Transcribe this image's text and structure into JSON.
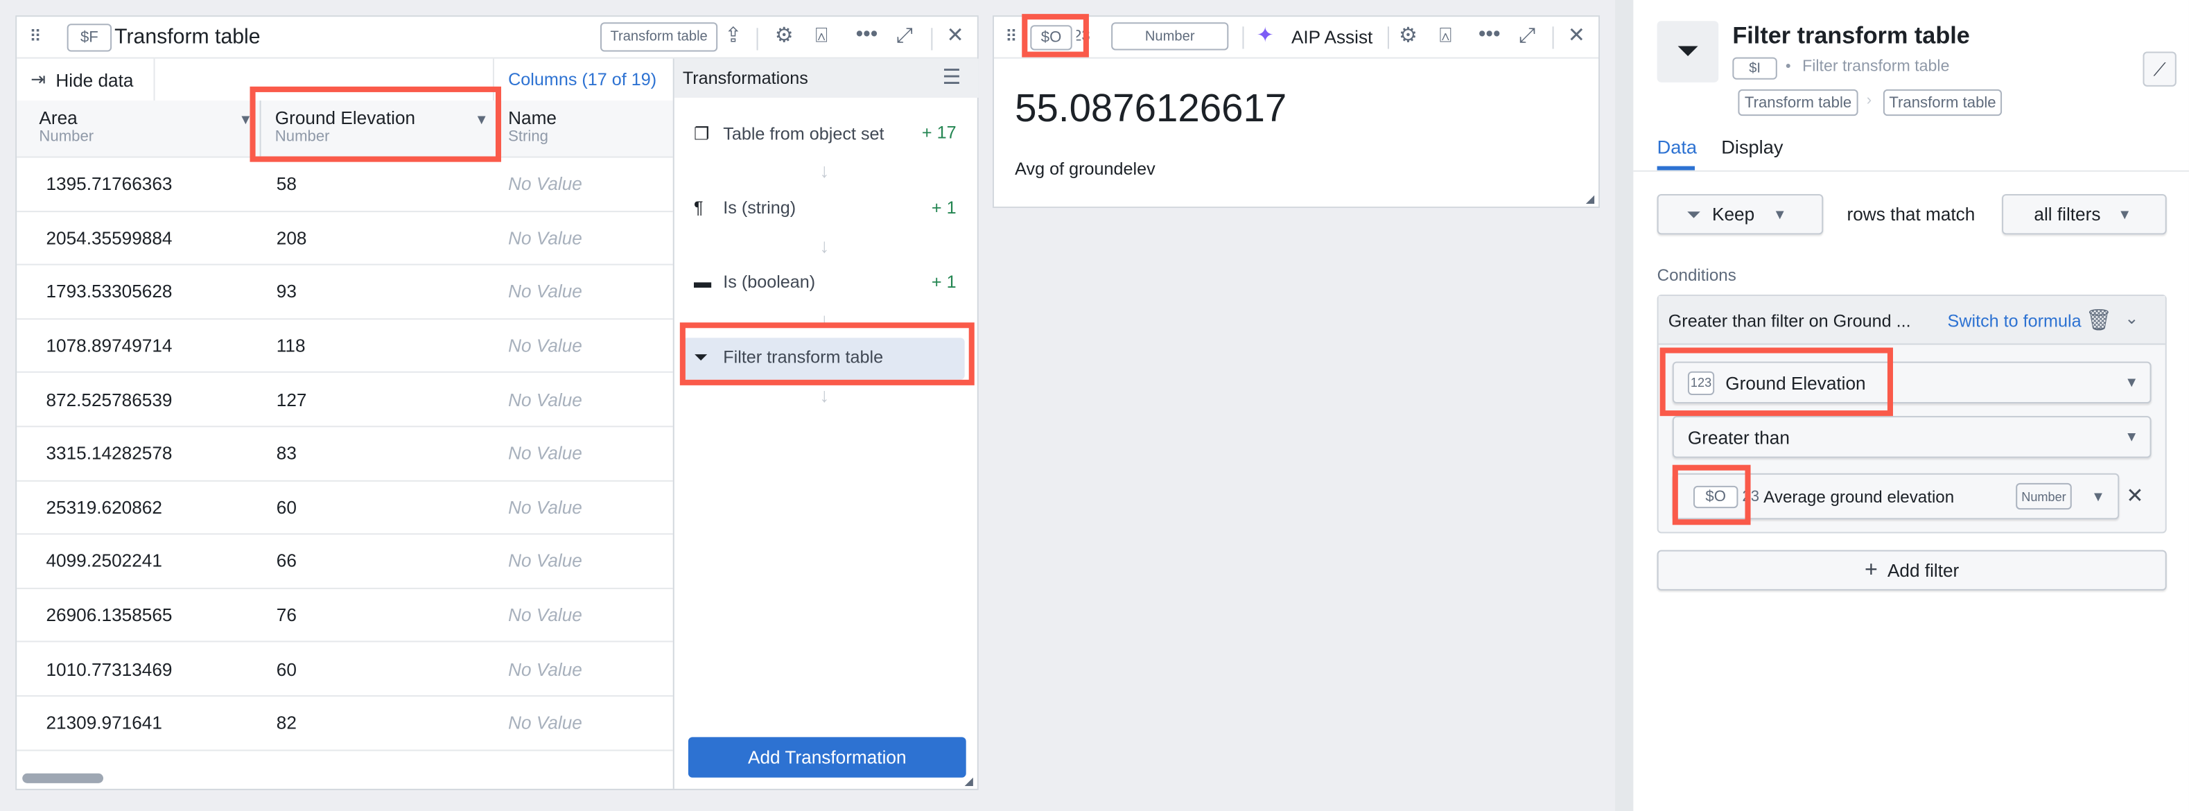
{
  "table_widget": {
    "variable": "$F",
    "title": "Transform table",
    "type_badge": "Transform table",
    "hide_data": "Hide data",
    "columns_link": "Columns (17 of 19)",
    "columns": [
      {
        "name": "Area",
        "type": "Number"
      },
      {
        "name": "Ground Elevation",
        "type": "Number"
      },
      {
        "name": "Name",
        "type": "String"
      }
    ],
    "rows": [
      [
        "1395.71766363",
        "58",
        "No Value"
      ],
      [
        "2054.35599884",
        "208",
        "No Value"
      ],
      [
        "1793.53305628",
        "93",
        "No Value"
      ],
      [
        "1078.89749714",
        "118",
        "No Value"
      ],
      [
        "872.525786539",
        "127",
        "No Value"
      ],
      [
        "3315.14282578",
        "83",
        "No Value"
      ],
      [
        "25319.620862",
        "60",
        "No Value"
      ],
      [
        "4099.2502241",
        "66",
        "No Value"
      ],
      [
        "26906.1358565",
        "76",
        "No Value"
      ],
      [
        "1010.77313469",
        "60",
        "No Value"
      ],
      [
        "21309.971641",
        "82",
        "No Value"
      ]
    ],
    "transformations": {
      "title": "Transformations",
      "steps": [
        {
          "label": "Table from object set",
          "count": "+ 17",
          "icon": "table-stack-icon"
        },
        {
          "label": "Is (string)",
          "count": "+ 1",
          "icon": "pilcrow-icon"
        },
        {
          "label": "Is (boolean)",
          "count": "+ 1",
          "icon": "boolean-toggle-icon"
        },
        {
          "label": "Filter transform table",
          "count": "",
          "icon": "filter-list-icon",
          "selected": true
        }
      ],
      "add_button": "Add Transformation"
    }
  },
  "metric_widget": {
    "variable": "$O",
    "type_prefix": "123",
    "type_badge": "Number",
    "aip_assist": "AIP Assist",
    "value": "55.0876126617",
    "caption": "Avg of groundelev"
  },
  "config_panel": {
    "title": "Filter transform table",
    "variable": "$I",
    "subtitle": "Filter transform table",
    "breadcrumb": [
      "Transform table",
      "Transform table"
    ],
    "tabs": [
      {
        "label": "Data",
        "active": true
      },
      {
        "label": "Display",
        "active": false
      }
    ],
    "keep_label": "Keep",
    "rows_that_match": "rows that match",
    "match_mode": "all filters",
    "conditions_label": "Conditions",
    "condition": {
      "title": "Greater than filter on Ground ...",
      "switch_formula": "Switch to formula",
      "field_type": "123",
      "field": "Ground Elevation",
      "operator": "Greater than",
      "value_variable": "$O",
      "value_type_prefix": "23",
      "value_label": "Average ground elevation",
      "value_type": "Number"
    },
    "add_filter": "Add filter"
  },
  "colors": {
    "accent": "#2d72d2",
    "highlight": "#fa5a4a",
    "positive": "#238551",
    "ai": "#7c5cf5"
  }
}
